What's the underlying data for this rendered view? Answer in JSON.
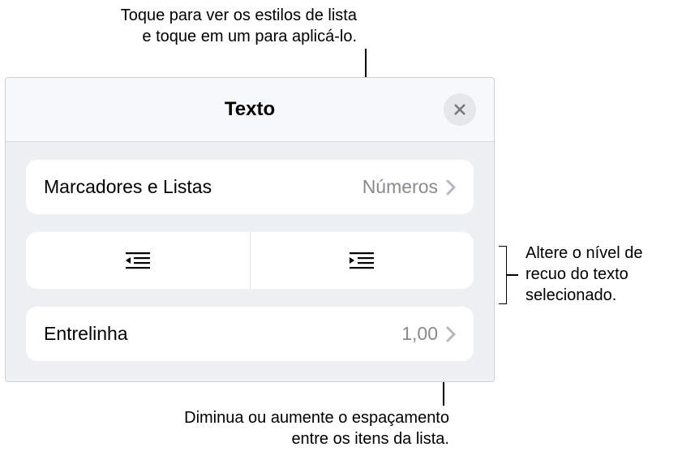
{
  "callouts": {
    "top": {
      "line1": "Toque para ver os estilos de lista",
      "line2": "e toque em um para aplicá-lo."
    },
    "right": {
      "line1": "Altere o nível de",
      "line2": "recuo do texto",
      "line3": "selecionado."
    },
    "bottom": {
      "line1": "Diminua ou aumente o espaçamento",
      "line2": "entre os itens da lista."
    }
  },
  "panel": {
    "title": "Texto",
    "bulletsRow": {
      "label": "Marcadores e Listas",
      "value": "Números"
    },
    "lineSpacingRow": {
      "label": "Entrelinha",
      "value": "1,00"
    }
  }
}
